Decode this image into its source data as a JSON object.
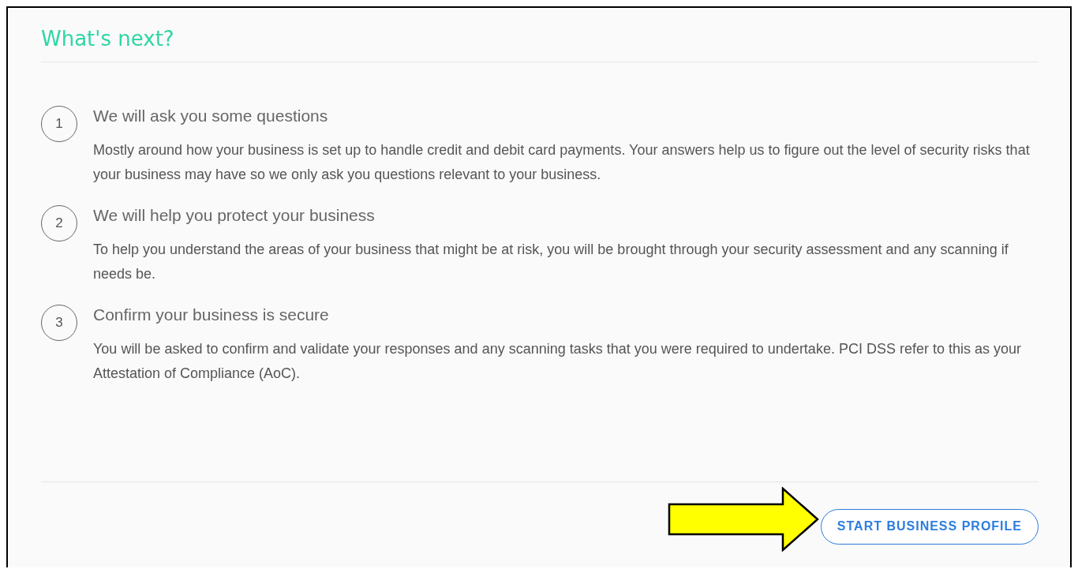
{
  "title": "What's next?",
  "steps": [
    {
      "number": "1",
      "heading": "We will ask you some questions",
      "text": "Mostly around how your business is set up to handle credit and debit card payments. Your answers help us to figure out the level of security risks that your business may have so we only ask you questions relevant to your business."
    },
    {
      "number": "2",
      "heading": "We will help you protect your business",
      "text": "To help you understand the areas of your business that might be at risk, you will be brought through your security assessment and any scanning if needs be."
    },
    {
      "number": "3",
      "heading": "Confirm your business is secure",
      "text": "You will be asked to confirm and validate your responses and any scanning tasks that you were required to undertake. PCI DSS refer to this as your Attestation of Compliance (AoC)."
    }
  ],
  "button": {
    "label": "START BUSINESS PROFILE"
  }
}
